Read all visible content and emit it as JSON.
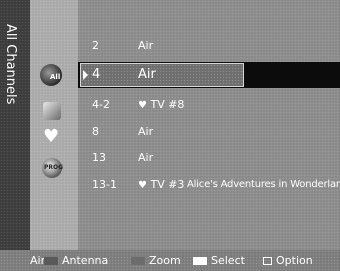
{
  "side_title": "All Channels",
  "mode_icons": {
    "all_label": "All",
    "added_label": "",
    "program_label": "PROG"
  },
  "channels": [
    {
      "number": "2",
      "type": "Air",
      "favorite": false,
      "program": ""
    },
    {
      "number": "4",
      "type": "Air",
      "favorite": false,
      "program": "",
      "selected": true
    },
    {
      "number": "4-2",
      "type": "TV #8",
      "favorite": true,
      "program": ""
    },
    {
      "number": "8",
      "type": "Air",
      "favorite": false,
      "program": ""
    },
    {
      "number": "13",
      "type": "Air",
      "favorite": false,
      "program": ""
    },
    {
      "number": "13-1",
      "type": "TV #3",
      "favorite": true,
      "program": "Alice's Adventures in Wonderland"
    }
  ],
  "bottom_bar": {
    "source": "Air",
    "antenna": "Antenna",
    "zoom": "Zoom",
    "select": "Select",
    "option": "Option"
  },
  "colors": {
    "background": "#8a8a8a",
    "selection_bar": "#0c0c0c",
    "text": "#ffffff"
  },
  "icons": {
    "favorite": "heart-icon",
    "option": "option-icon"
  }
}
